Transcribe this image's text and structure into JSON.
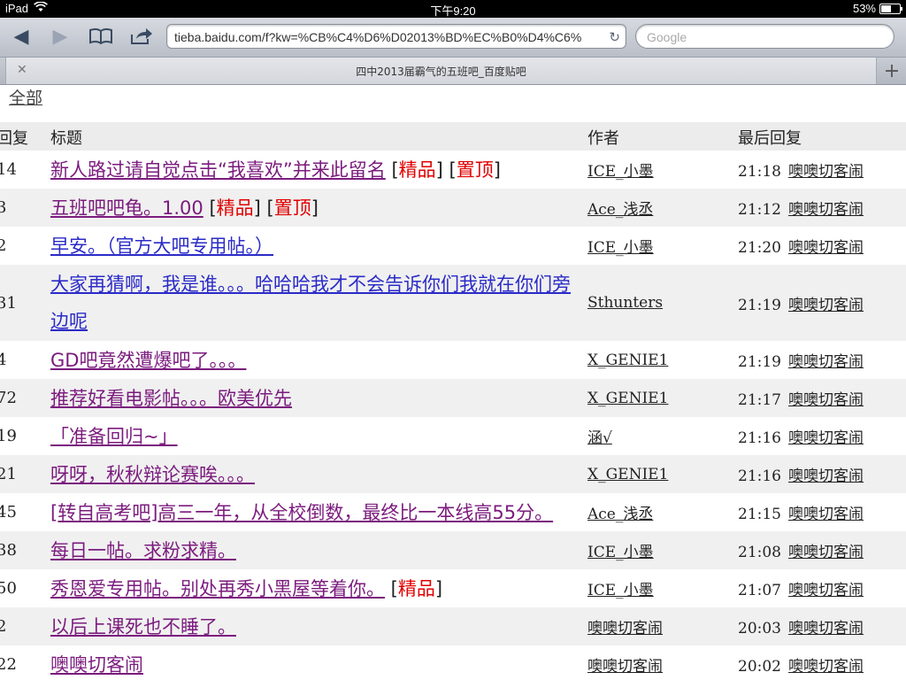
{
  "status_bar": {
    "device": "iPad",
    "time": "下午9:20",
    "battery": "53%",
    "battery_level": 0.53
  },
  "toolbar": {
    "url": "tieba.baidu.com/f?kw=%CB%C4%D6%D02013%BD%EC%B0%D4%C6%",
    "search_placeholder": "Google"
  },
  "tab": {
    "title": "四中2013届霸气的五班吧_百度贴吧"
  },
  "page": {
    "all_link": "全部"
  },
  "table": {
    "headers": {
      "replies": "回复",
      "title": "标题",
      "author": "作者",
      "last_reply": "最后回复"
    },
    "rows": [
      {
        "replies": "14",
        "title": "新人路过请自觉点击“我喜欢”并来此留名",
        "tags": [
          "精品",
          "置顶"
        ],
        "author": "ICE_小墨",
        "time": "21:18",
        "last_user": "噢噢切客闹"
      },
      {
        "replies": "3",
        "title": "五班吧吧龟。1.00",
        "tags": [
          "精品",
          "置顶"
        ],
        "author": "Ace_浅丞",
        "time": "21:12",
        "last_user": "噢噢切客闹"
      },
      {
        "replies": "2",
        "title": "早安。（官方大吧专用帖。）",
        "tags": [],
        "author": "ICE_小墨",
        "time": "21:20",
        "last_user": "噢噢切客闹",
        "blue": true
      },
      {
        "replies": "31",
        "title": "大家再猜啊，我是谁。。。哈哈哈我才不会告诉你们我就在你们旁边呢",
        "tags": [],
        "author": "Sthunters",
        "time": "21:19",
        "last_user": "噢噢切客闹",
        "blue": true,
        "tall": true
      },
      {
        "replies": "4",
        "title": "GD吧竟然遭爆吧了。。。",
        "tags": [],
        "author": "X_GENIE1",
        "time": "21:19",
        "last_user": "噢噢切客闹"
      },
      {
        "replies": "72",
        "title": "推荐好看电影帖。。。欧美优先",
        "tags": [],
        "author": "X_GENIE1",
        "time": "21:17",
        "last_user": "噢噢切客闹"
      },
      {
        "replies": "19",
        "title": "「准备回归~」",
        "tags": [],
        "author": "涵√",
        "time": "21:16",
        "last_user": "噢噢切客闹"
      },
      {
        "replies": "21",
        "title": "呀呀，秋秋辩论赛唉。。。",
        "tags": [],
        "author": "X_GENIE1",
        "time": "21:16",
        "last_user": "噢噢切客闹"
      },
      {
        "replies": "45",
        "title": "[转自高考吧]高三一年，从全校倒数，最终比一本线高55分。",
        "tags": [],
        "author": "Ace_浅丞",
        "time": "21:15",
        "last_user": "噢噢切客闹"
      },
      {
        "replies": "38",
        "title": "每日一帖。求粉求精。",
        "tags": [],
        "author": "ICE_小墨",
        "time": "21:08",
        "last_user": "噢噢切客闹"
      },
      {
        "replies": "50",
        "title": "秀恩爱专用帖。别处再秀小黑屋等着你。",
        "tags": [
          "精品"
        ],
        "author": "ICE_小墨",
        "time": "21:07",
        "last_user": "噢噢切客闹"
      },
      {
        "replies": "2",
        "title": "以后上课死也不睡了。",
        "tags": [],
        "author": "噢噢切客闹",
        "time": "20:03",
        "last_user": "噢噢切客闹"
      },
      {
        "replies": "22",
        "title": "噢噢切客闹",
        "tags": [],
        "author": "噢噢切客闹",
        "time": "20:02",
        "last_user": "噢噢切客闹"
      }
    ]
  }
}
